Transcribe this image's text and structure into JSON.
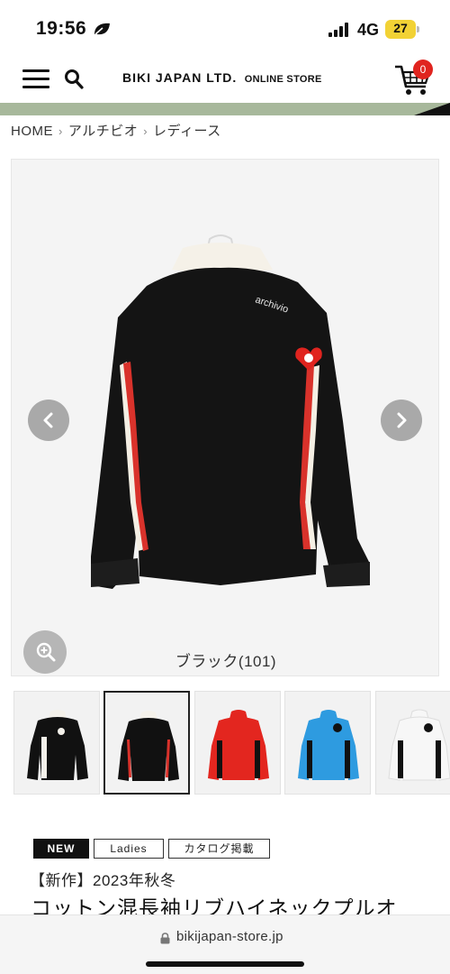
{
  "status_bar": {
    "time": "19:56",
    "network": "4G",
    "battery": "27"
  },
  "header": {
    "logo_main": "BIKI JAPAN LTD.",
    "logo_sub": "ONLINE STORE",
    "cart_count": "0",
    "icons": [
      "menu-icon",
      "search-icon",
      "cart-icon"
    ]
  },
  "breadcrumb": {
    "items": [
      "HOME",
      "アルチビオ",
      "レディース"
    ],
    "separator": "›"
  },
  "product_image": {
    "color_caption": "ブラック(101)",
    "chest_logo": "archivio",
    "icons": [
      "chevron-left-icon",
      "chevron-right-icon",
      "zoom-icon"
    ]
  },
  "thumbnails": [
    {
      "color": "#111111",
      "accent": "#f4f1ea"
    },
    {
      "color": "#111111",
      "accent": "#d9322b"
    },
    {
      "color": "#e3261f",
      "accent": "#111111"
    },
    {
      "color": "#2e9be0",
      "accent": "#111111"
    },
    {
      "color": "#f7f7f7",
      "accent": "#111111"
    }
  ],
  "tags": {
    "new": "NEW",
    "ladies": "Ladies",
    "catalog": "カタログ掲載"
  },
  "product": {
    "season": "【新作】2023年秋冬",
    "title": "コットン混長袖リブハイネックプルオ"
  },
  "browser": {
    "url": "bikijapan-store.jp"
  },
  "colors": {
    "banner_green": "#a7b89b",
    "badge_red": "#e0241f",
    "battery_yellow": "#f2d235"
  }
}
